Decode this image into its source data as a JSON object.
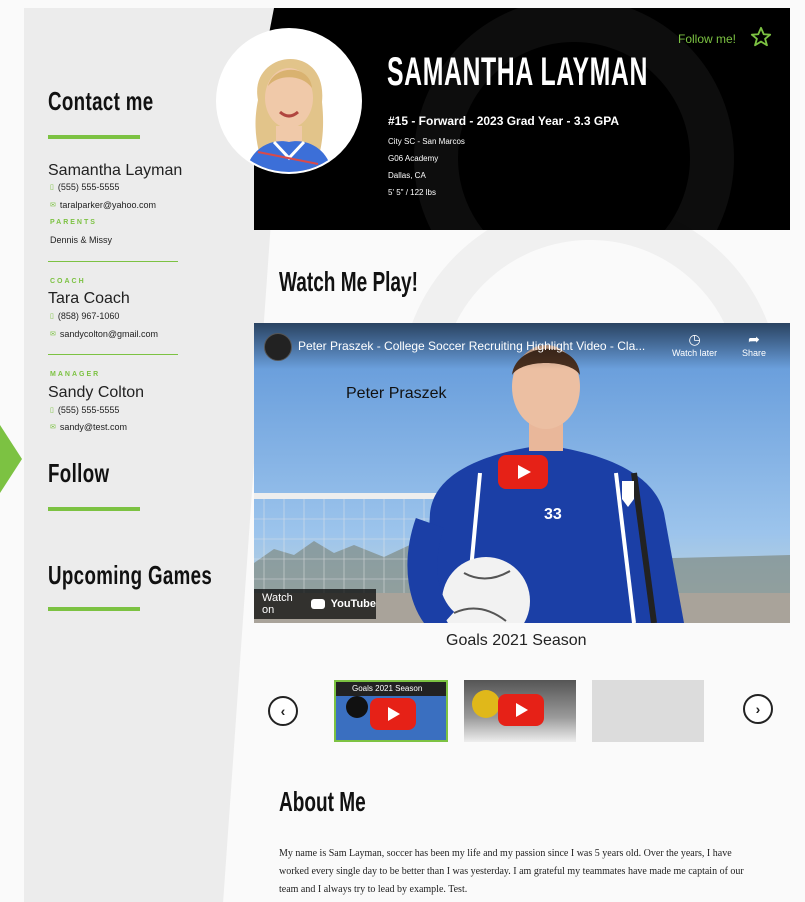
{
  "sidebar": {
    "contact_heading": "Contact me",
    "contacts": [
      {
        "name": "Samantha Layman",
        "phone": "(555) 555-5555",
        "email": "taralparker@yahoo.com",
        "role": "PARENTS",
        "role_name": "Dennis & Missy"
      },
      {
        "role": "COACH",
        "name": "Tara Coach",
        "phone": "(858) 967-1060",
        "email": "sandycolton@gmail.com"
      },
      {
        "role": "MANAGER",
        "name": "Sandy Colton",
        "phone": "(555) 555-5555",
        "email": "sandy@test.com"
      }
    ],
    "follow_heading": "Follow",
    "games_heading": "Upcoming Games"
  },
  "header": {
    "name": "SAMANTHA LAYMAN",
    "main_line": "#15 - Forward - 2023 Grad Year - 3.3 GPA",
    "details": [
      "City SC - San Marcos",
      "G06 Academy",
      "Dallas, CA",
      "5' 5\" / 122 lbs"
    ],
    "follow_label": "Follow me!"
  },
  "watch": {
    "heading": "Watch Me Play!",
    "video_title": "Peter Praszek - College Soccer Recruiting Highlight Video - Cla...",
    "watch_later": "Watch later",
    "share": "Share",
    "overlay_name": "Peter Praszek",
    "jersey_number": "33",
    "watch_on": "Watch on",
    "youtube": "YouTube",
    "caption": "Goals 2021 Season"
  },
  "carousel": {
    "thumb1_title": "Goals 2021 Season"
  },
  "about": {
    "heading": "About Me",
    "text": "My name is Sam Layman, soccer has been my life and my passion since I was 5 years old. Over the years, I have worked every single day to be better than I was yesterday. I am grateful my teammates have made me captain of our team and I always try to lead by example. Test."
  },
  "colors": {
    "accent": "#7cc242",
    "header_bg": "#000000",
    "sidebar_bg": "#ececec",
    "youtube_red": "#e62117"
  }
}
